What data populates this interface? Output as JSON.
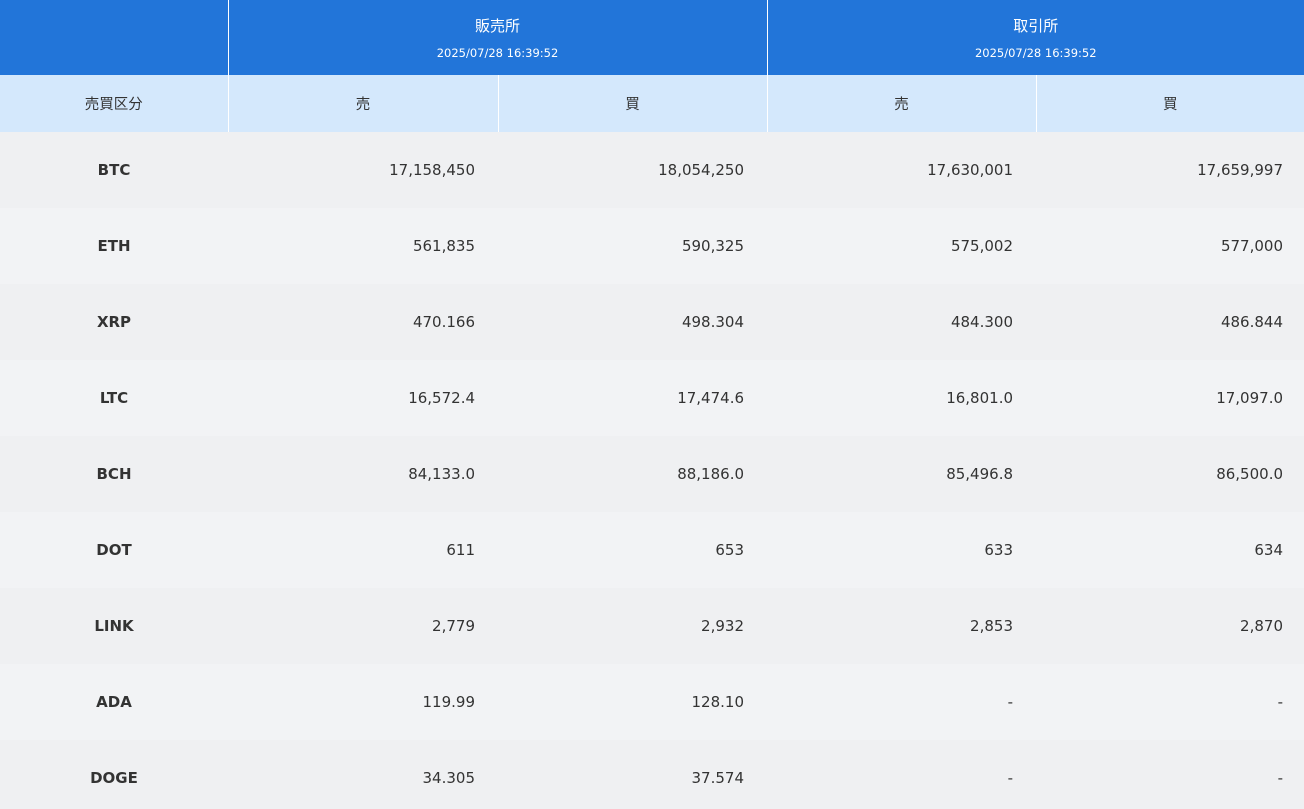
{
  "header": {
    "groups": [
      {
        "title": "販売所",
        "time": "2025/07/28 16:39:52"
      },
      {
        "title": "取引所",
        "time": "2025/07/28 16:39:52"
      }
    ]
  },
  "subheader": {
    "type_label": "売買区分",
    "columns": [
      "売",
      "買",
      "売",
      "買"
    ]
  },
  "rows": [
    {
      "symbol": "BTC",
      "values": [
        "17,158,450",
        "18,054,250",
        "17,630,001",
        "17,659,997"
      ]
    },
    {
      "symbol": "ETH",
      "values": [
        "561,835",
        "590,325",
        "575,002",
        "577,000"
      ]
    },
    {
      "symbol": "XRP",
      "values": [
        "470.166",
        "498.304",
        "484.300",
        "486.844"
      ]
    },
    {
      "symbol": "LTC",
      "values": [
        "16,572.4",
        "17,474.6",
        "16,801.0",
        "17,097.0"
      ]
    },
    {
      "symbol": "BCH",
      "values": [
        "84,133.0",
        "88,186.0",
        "85,496.8",
        "86,500.0"
      ]
    },
    {
      "symbol": "DOT",
      "values": [
        "611",
        "653",
        "633",
        "634"
      ]
    },
    {
      "symbol": "LINK",
      "values": [
        "2,779",
        "2,932",
        "2,853",
        "2,870"
      ]
    },
    {
      "symbol": "ADA",
      "values": [
        "119.99",
        "128.10",
        "-",
        "-"
      ]
    },
    {
      "symbol": "DOGE",
      "values": [
        "34.305",
        "37.574",
        "-",
        "-"
      ]
    }
  ],
  "colors": {
    "header_bg": "#2275d9",
    "subheader_bg": "#d4e8fc",
    "row_bg_a": "#eff0f2",
    "row_bg_b": "#f2f3f5",
    "text": "#333333"
  }
}
